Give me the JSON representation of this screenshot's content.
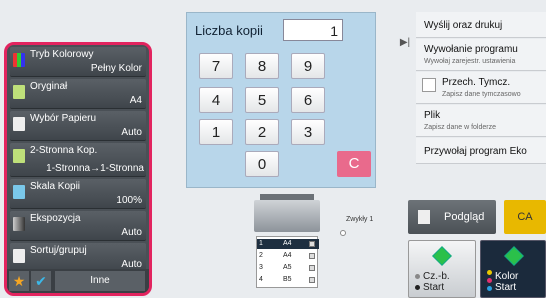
{
  "left_panel": {
    "items": [
      {
        "name": "Tryb Kolorowy",
        "value": "Pełny Kolor"
      },
      {
        "name": "Oryginał",
        "value": "A4"
      },
      {
        "name": "Wybór Papieru",
        "value": "Auto"
      },
      {
        "name": "2-Stronna Kop.",
        "value": "1-Stronna→1-Stronna"
      },
      {
        "name": "Skala Kopii",
        "value": "100%"
      },
      {
        "name": "Ekspozycja",
        "value": "Auto"
      },
      {
        "name": "Sortuj/grupuj",
        "value": "Auto"
      }
    ],
    "other_label": "Inne",
    "favorite_icon": "star-icon",
    "confirm_icon": "check-icon"
  },
  "keypad": {
    "title": "Liczba kopii",
    "display_value": "1",
    "keys": [
      "7",
      "8",
      "9",
      "4",
      "5",
      "6",
      "1",
      "2",
      "3",
      "0"
    ],
    "clear_label": "C"
  },
  "right_list": {
    "items": [
      {
        "title": "Wyślij oraz drukuj",
        "sub": ""
      },
      {
        "title": "Wywołanie programu",
        "sub": "Wywołaj zarejestr. ustawienia"
      },
      {
        "title": "Przech. Tymcz.",
        "sub": "Zapisz dane tymczasowo"
      },
      {
        "title": "Plik",
        "sub": "Zapisz dane w folderze"
      },
      {
        "title": "Przywołaj program Eko",
        "sub": ""
      }
    ]
  },
  "trays": {
    "output_label": "Zwykły 1",
    "rows": [
      {
        "n": "1",
        "size": "A4"
      },
      {
        "n": "2",
        "size": "A4"
      },
      {
        "n": "3",
        "size": "A5"
      },
      {
        "n": "4",
        "size": "B5"
      }
    ]
  },
  "buttons": {
    "preview": "Podgląd",
    "ca": "CA",
    "start_bw_line1": "Cz.-b.",
    "start_bw_line2": "Start",
    "start_color_line1": "Kolor",
    "start_color_line2": "Start"
  },
  "colors": {
    "highlight_border": "#e2245f",
    "keypad_bg": "#b8d6ea",
    "clear_key": "#e96a8c",
    "ca_button": "#e8b800",
    "start_diamond": "#2bc04a"
  }
}
